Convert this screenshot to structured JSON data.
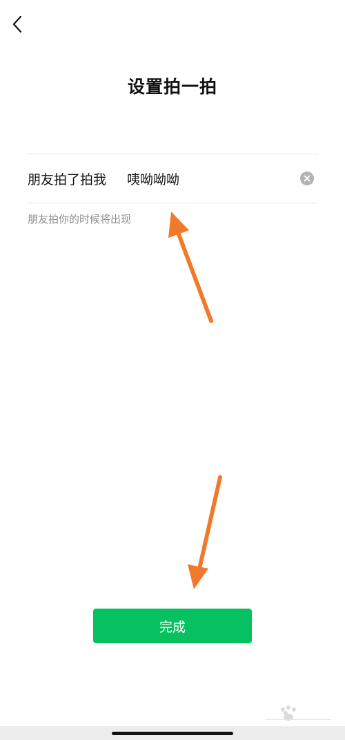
{
  "header": {
    "back_icon": "chevron-left-icon",
    "title": "设置拍一拍"
  },
  "pat_setting": {
    "prefix": "朋友拍了拍我",
    "suffix_value": "咦呦呦呦",
    "clear_icon": "clear-circle-icon",
    "hint": "朋友拍你的时候将出现"
  },
  "done_button": {
    "label": "完成"
  },
  "colors": {
    "accent": "#07c160",
    "annotation_arrow": "#f07a2a",
    "hint_text": "#8c8c8c"
  }
}
